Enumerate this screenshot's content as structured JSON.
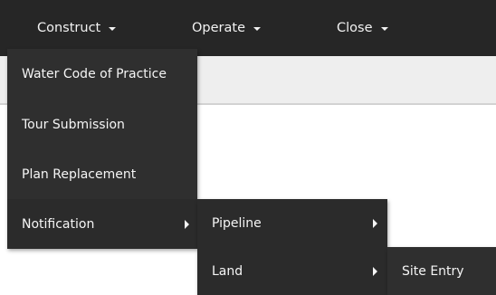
{
  "navbar": {
    "items": [
      {
        "label": "Construct"
      },
      {
        "label": "Operate"
      },
      {
        "label": "Close"
      }
    ]
  },
  "construct_menu": {
    "items": [
      {
        "label": "Water Code of Practice"
      },
      {
        "label": "Tour Submission"
      },
      {
        "label": "Plan Replacement"
      },
      {
        "label": "Notification"
      }
    ]
  },
  "notification_submenu": {
    "items": [
      {
        "label": "Pipeline"
      },
      {
        "label": "Land"
      }
    ]
  },
  "land_submenu": {
    "items": [
      {
        "label": "Site Entry"
      }
    ]
  },
  "colors": {
    "navbar_bg": "#262626",
    "menu_bg": "#2f2f2f",
    "text": "#f5f5f5",
    "page_strip": "#eeeeee"
  }
}
